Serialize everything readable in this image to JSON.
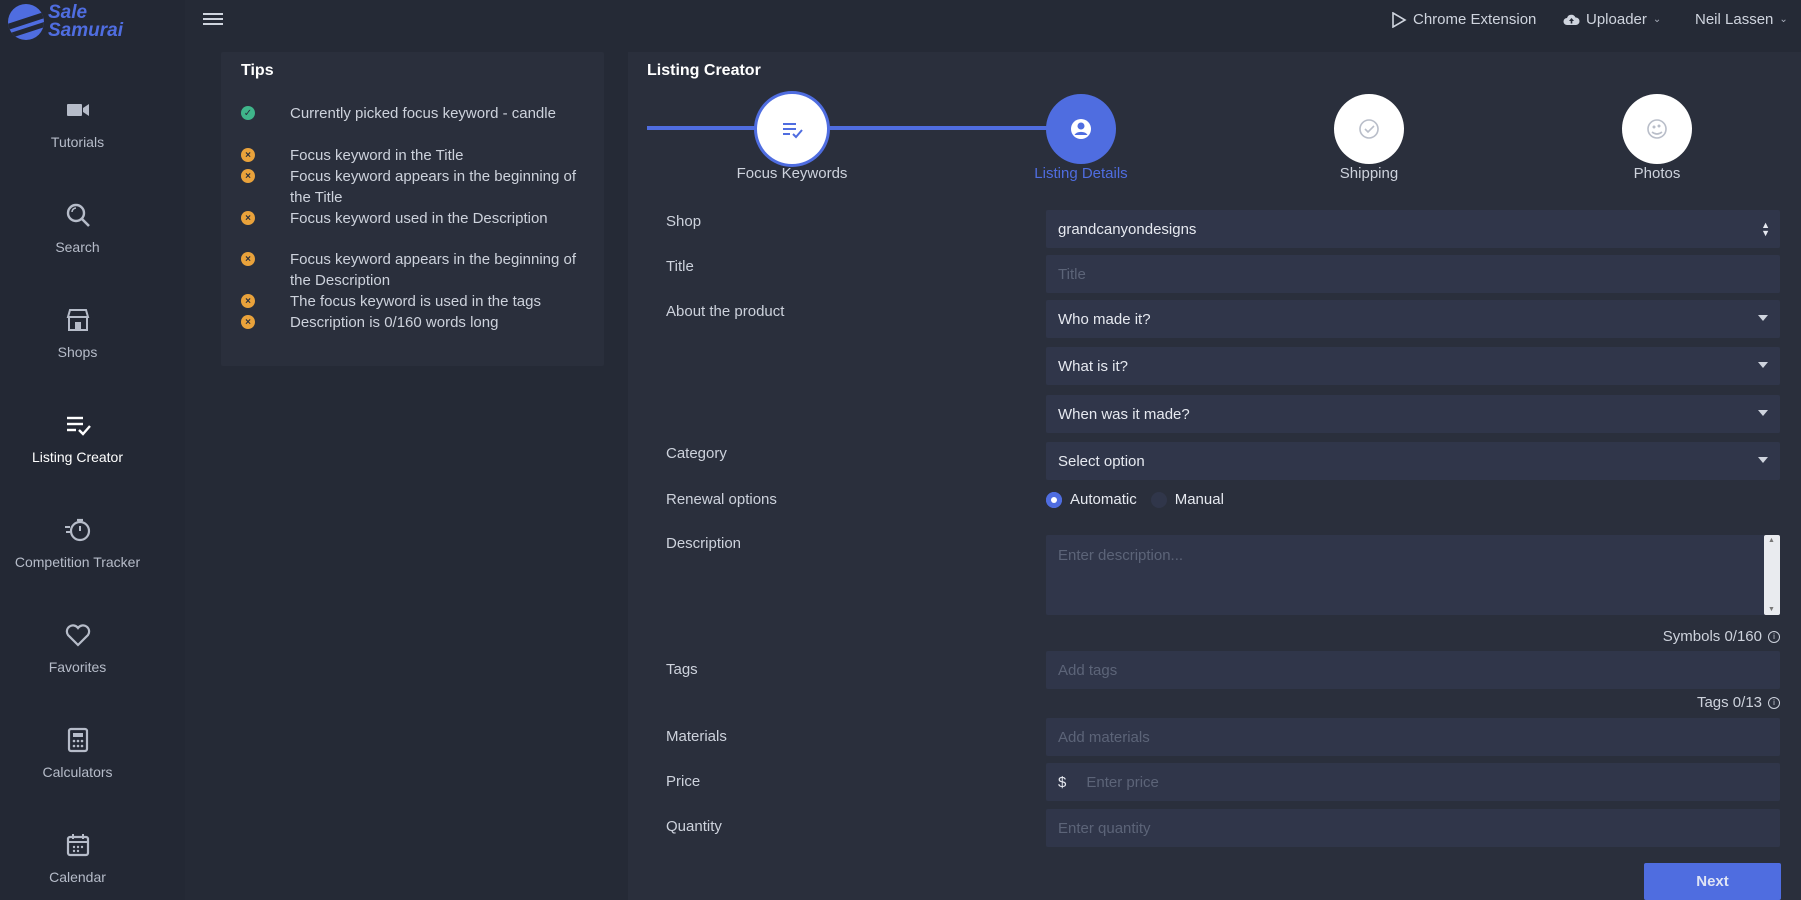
{
  "brand": {
    "line1": "Sale",
    "line2": "Samurai",
    "color": "#4f6de0"
  },
  "sidebar": {
    "items": [
      {
        "label": "Tutorials",
        "icon": "video-camera-icon",
        "active": false
      },
      {
        "label": "Search",
        "icon": "search-icon",
        "active": false
      },
      {
        "label": "Shops",
        "icon": "shop-icon",
        "active": false
      },
      {
        "label": "Listing Creator",
        "icon": "list-check-icon",
        "active": true
      },
      {
        "label": "Competition Tracker",
        "icon": "stopwatch-icon",
        "active": false
      },
      {
        "label": "Favorites",
        "icon": "heart-icon",
        "active": false
      },
      {
        "label": "Calculators",
        "icon": "calculator-icon",
        "active": false
      },
      {
        "label": "Calendar",
        "icon": "calendar-icon",
        "active": false
      }
    ]
  },
  "topbar": {
    "chrome_extension": "Chrome Extension",
    "uploader": "Uploader",
    "user": "Neil Lassen"
  },
  "tips": {
    "title": "Tips",
    "items": [
      {
        "text": "Currently picked focus keyword - candle",
        "status": "ok"
      },
      {
        "text": "Focus keyword in the Title",
        "status": "bad"
      },
      {
        "text": "Focus keyword appears in the beginning of the Title",
        "status": "bad"
      },
      {
        "text": "Focus keyword used in the Description",
        "status": "bad"
      },
      {
        "text": "Focus keyword appears in the beginning of the Description",
        "status": "bad"
      },
      {
        "text": "The focus keyword is used in the tags",
        "status": "bad"
      },
      {
        "text": "Description is 0/160 words long",
        "status": "bad"
      }
    ]
  },
  "listing": {
    "title": "Listing Creator",
    "steps": [
      {
        "label": "Focus Keywords",
        "icon": "list-check-icon",
        "state": "done"
      },
      {
        "label": "Listing Details",
        "icon": "user-circle-icon",
        "state": "active"
      },
      {
        "label": "Shipping",
        "icon": "check-circle-icon",
        "state": "todo"
      },
      {
        "label": "Photos",
        "icon": "photo-icon",
        "state": "todo"
      }
    ],
    "form": {
      "shop_label": "Shop",
      "shop_value": "grandcanyondesigns",
      "title_label": "Title",
      "title_placeholder": "Title",
      "about_label": "About the product",
      "who_made": "Who made it?",
      "what_is": "What is it?",
      "when_made": "When was it made?",
      "category_label": "Category",
      "category_value": "Select option",
      "renewal_label": "Renewal options",
      "renewal_automatic": "Automatic",
      "renewal_manual": "Manual",
      "description_label": "Description",
      "description_placeholder": "Enter description...",
      "symbols_counter": "Symbols 0/160",
      "tags_label": "Tags",
      "tags_placeholder": "Add tags",
      "tags_counter": "Tags 0/13",
      "materials_label": "Materials",
      "materials_placeholder": "Add materials",
      "price_label": "Price",
      "price_prefix": "$",
      "price_placeholder": "Enter price",
      "quantity_label": "Quantity",
      "quantity_placeholder": "Enter quantity",
      "next_label": "Next"
    }
  }
}
